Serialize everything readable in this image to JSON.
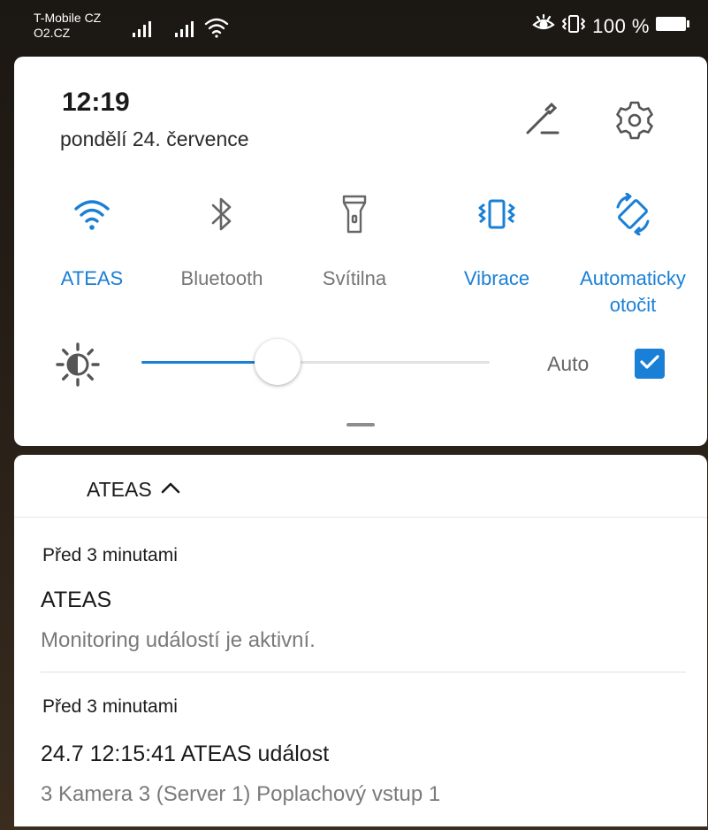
{
  "status_bar": {
    "carrier_1": "T-Mobile CZ",
    "carrier_2": "O2.CZ",
    "battery_percent": "100 %",
    "icons": [
      "signal-icon",
      "signal-icon",
      "wifi-icon",
      "eye-comfort-icon",
      "vibrate-icon",
      "battery-icon"
    ]
  },
  "quick_settings": {
    "time": "12:19",
    "date": "pondělí 24. července",
    "edit_icon": "edit-icon",
    "settings_icon": "gear-icon",
    "tiles": [
      {
        "label": "ATEAS",
        "icon": "wifi-icon",
        "active": true
      },
      {
        "label": "Bluetooth",
        "icon": "bluetooth-icon",
        "active": false
      },
      {
        "label": "Svítilna",
        "icon": "flashlight-icon",
        "active": false
      },
      {
        "label": "Vibrace",
        "icon": "vibrate-icon",
        "active": true
      },
      {
        "label_line1": "Automaticky",
        "label_line2": "otočit",
        "icon": "auto-rotate-icon",
        "active": true
      }
    ],
    "brightness": {
      "icon": "brightness-icon",
      "level": 0.39,
      "auto_label": "Auto",
      "auto_checked": true
    }
  },
  "notifications": {
    "app_name": "ATEAS",
    "items": [
      {
        "time": "Před 3 minutami",
        "title": "ATEAS",
        "body": "Monitoring událostí je aktivní."
      },
      {
        "time": "Před 3 minutami",
        "title": "24.7 12:15:41 ATEAS událost",
        "body": "3 Kamera 3 (Server 1) Poplachový vstup 1"
      }
    ]
  },
  "colors": {
    "accent": "#1a7fd6",
    "inactive_label": "#757575",
    "panel_background": "#ffffff"
  }
}
